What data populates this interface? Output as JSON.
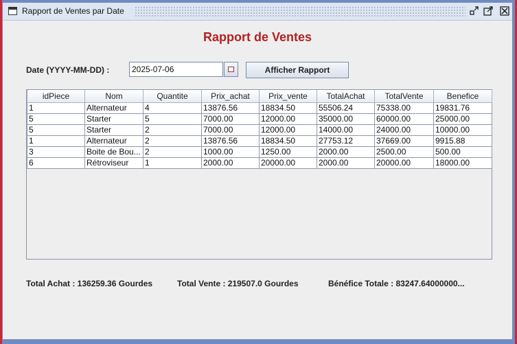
{
  "window": {
    "title": "Rapport de Ventes par Date",
    "controls": [
      "minimize-icon",
      "maximize-icon",
      "close-icon"
    ]
  },
  "heading": "Rapport de Ventes",
  "heading_color": "#b22222",
  "date_filter": {
    "label": "Date (YYYY-MM-DD) :",
    "value": "2025-07-06",
    "button_label": "Afficher Rapport"
  },
  "table": {
    "columns": [
      "idPiece",
      "Nom",
      "Quantite",
      "Prix_achat",
      "Prix_vente",
      "TotalAchat",
      "TotalVente",
      "Benefice"
    ],
    "rows": [
      [
        "1",
        "Alternateur",
        "4",
        "13876.56",
        "18834.50",
        "55506.24",
        "75338.00",
        "19831.76"
      ],
      [
        "5",
        "Starter",
        "5",
        "7000.00",
        "12000.00",
        "35000.00",
        "60000.00",
        "25000.00"
      ],
      [
        "5",
        "Starter",
        "2",
        "7000.00",
        "12000.00",
        "14000.00",
        "24000.00",
        "10000.00"
      ],
      [
        "1",
        "Alternateur",
        "2",
        "13876.56",
        "18834.50",
        "27753.12",
        "37669.00",
        "9915.88"
      ],
      [
        "3",
        "Boite de Bou...",
        "2",
        "1000.00",
        "1250.00",
        "2000.00",
        "2500.00",
        "500.00"
      ],
      [
        "6",
        "Rétroviseur",
        "1",
        "2000.00",
        "20000.00",
        "2000.00",
        "20000.00",
        "18000.00"
      ]
    ]
  },
  "totals": {
    "achat": "Total Achat : 136259.36 Gourdes",
    "vente": "Total Vente : 219507.0 Gourdes",
    "benefice": "Bénéfice Totale : 83247.64000000..."
  }
}
